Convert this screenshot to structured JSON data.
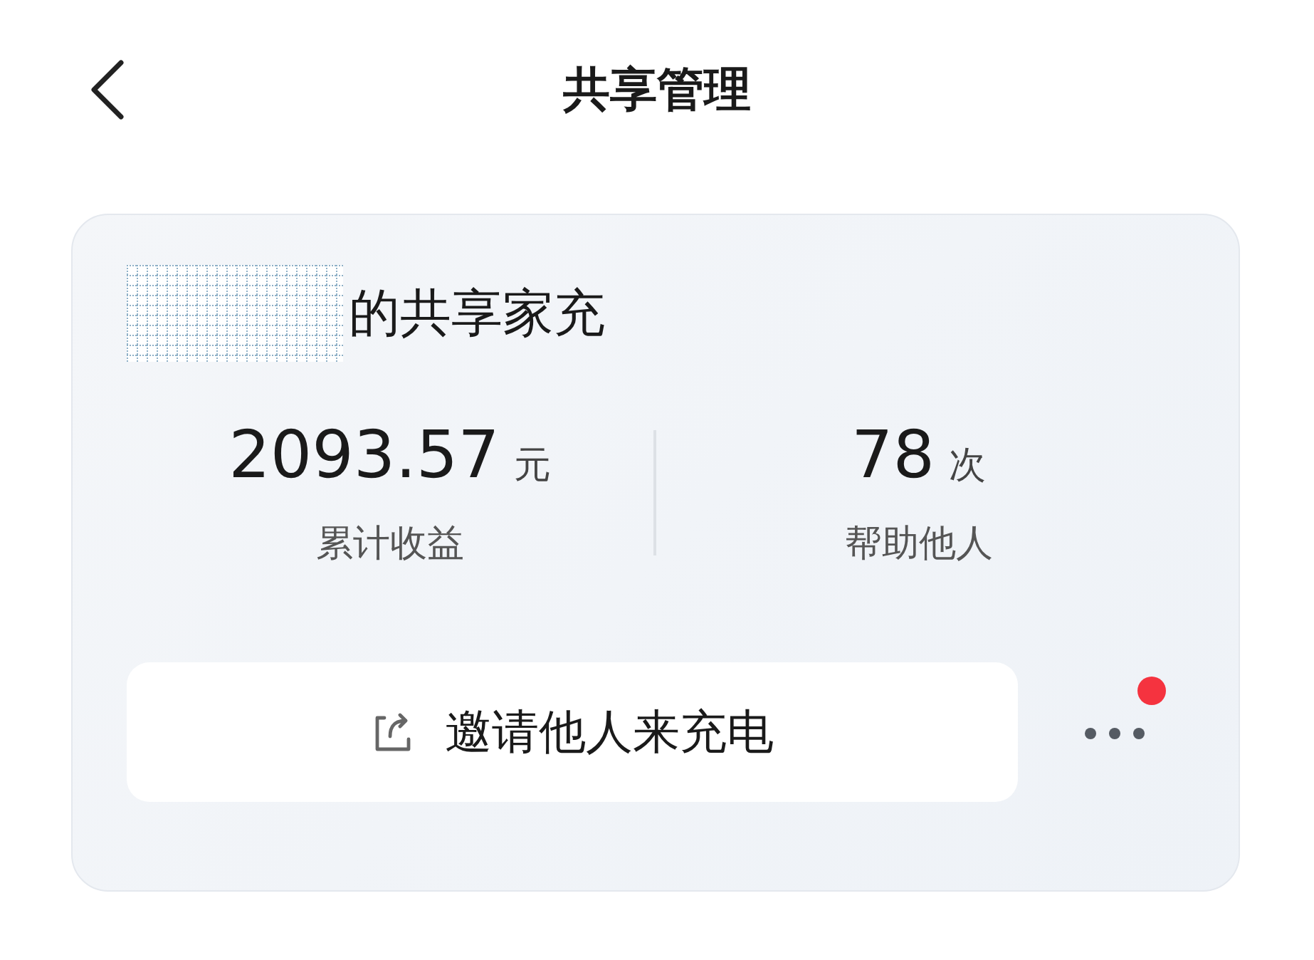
{
  "header": {
    "title": "共享管理"
  },
  "card": {
    "title": "的共享家充",
    "stats": [
      {
        "value": "2093.57",
        "unit": "元",
        "label": "累计收益"
      },
      {
        "value": "78",
        "unit": "次",
        "label": "帮助他人"
      }
    ],
    "invite_button": "邀请他人来充电",
    "more": {
      "badge": true
    }
  }
}
